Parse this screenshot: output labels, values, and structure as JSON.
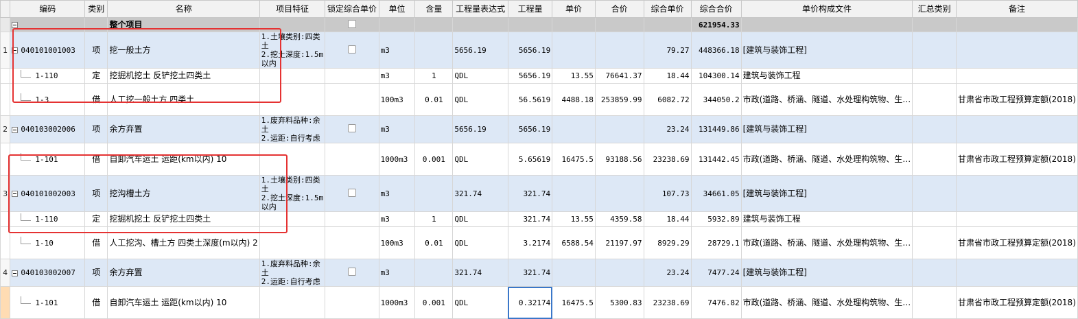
{
  "columns": [
    "编码",
    "类别",
    "名称",
    "项目特征",
    "锁定综合单价",
    "单位",
    "含量",
    "工程量表达式",
    "工程量",
    "单价",
    "合价",
    "综合单价",
    "综合合价",
    "单价构成文件",
    "汇总类别",
    "备注"
  ],
  "highlight_color": "#e53232",
  "whole": {
    "label": "整个项目",
    "total": "621954.33",
    "toggle_icon": "collapse-icon"
  },
  "rows": [
    {
      "type": "qd",
      "num": "1",
      "code": "040101001003",
      "cat": "项",
      "name": "挖一般土方",
      "feat": "1.土壤类别:四类土\n2.挖土深度:1.5m 以内",
      "lock": true,
      "unit": "m3",
      "content": "",
      "expr": "5656.19",
      "qty": "5656.19",
      "price": "",
      "amount": "",
      "cprice": "79.27",
      "ctotal": "448366.18",
      "file": "[建筑与装饰工程]",
      "sum": "",
      "note": ""
    },
    {
      "type": "sub",
      "num": "",
      "code": "1-110",
      "cat": "定",
      "name": "挖掘机挖土 反铲挖土四类土",
      "feat": "",
      "lock": false,
      "unit": "m3",
      "content": "1",
      "expr": "QDL",
      "qty": "5656.19",
      "price": "13.55",
      "amount": "76641.37",
      "cprice": "18.44",
      "ctotal": "104300.14",
      "file": "建筑与装饰工程",
      "sum": "",
      "note": ""
    },
    {
      "type": "sub",
      "num": "",
      "code": "1-3",
      "cat": "借",
      "name": "人工挖一般土方 四类土",
      "feat": "",
      "lock": false,
      "unit": "100m3",
      "content": "0.01",
      "expr": "QDL",
      "qty": "56.5619",
      "price": "4488.18",
      "amount": "253859.99",
      "cprice": "6082.72",
      "ctotal": "344050.2",
      "file": "市政(道路、桥涵、隧道、水处理构筑物、生…",
      "sum": "",
      "note": "甘肃省市政工程预算定额(2018)"
    },
    {
      "type": "qd",
      "num": "2",
      "code": "040103002006",
      "cat": "项",
      "name": "余方弃置",
      "feat": "1.废弃料品种:余土\n2.运距:自行考虑",
      "lock": true,
      "unit": "m3",
      "content": "",
      "expr": "5656.19",
      "qty": "5656.19",
      "price": "",
      "amount": "",
      "cprice": "23.24",
      "ctotal": "131449.86",
      "file": "[建筑与装饰工程]",
      "sum": "",
      "note": ""
    },
    {
      "type": "sub",
      "num": "",
      "code": "1-101",
      "cat": "借",
      "name": "自卸汽车运土 运距(km以内) 10",
      "feat": "",
      "lock": false,
      "unit": "1000m3",
      "content": "0.001",
      "expr": "QDL",
      "qty": "5.65619",
      "price": "16475.5",
      "amount": "93188.56",
      "cprice": "23238.69",
      "ctotal": "131442.45",
      "file": "市政(道路、桥涵、隧道、水处理构筑物、生…",
      "sum": "",
      "note": "甘肃省市政工程预算定额(2018)"
    },
    {
      "type": "qd",
      "num": "3",
      "code": "040101002003",
      "cat": "项",
      "name": "挖沟槽土方",
      "feat": "1.土壤类别:四类土\n2.挖土深度:1.5m 以内",
      "lock": true,
      "unit": "m3",
      "content": "",
      "expr": "321.74",
      "qty": "321.74",
      "price": "",
      "amount": "",
      "cprice": "107.73",
      "ctotal": "34661.05",
      "file": "[建筑与装饰工程]",
      "sum": "",
      "note": ""
    },
    {
      "type": "sub",
      "num": "",
      "code": "1-110",
      "cat": "定",
      "name": "挖掘机挖土 反铲挖土四类土",
      "feat": "",
      "lock": false,
      "unit": "m3",
      "content": "1",
      "expr": "QDL",
      "qty": "321.74",
      "price": "13.55",
      "amount": "4359.58",
      "cprice": "18.44",
      "ctotal": "5932.89",
      "file": "建筑与装饰工程",
      "sum": "",
      "note": ""
    },
    {
      "type": "sub",
      "num": "",
      "code": "1-10",
      "cat": "借",
      "name": "人工挖沟、槽土方 四类土深度(m以内) 2",
      "feat": "",
      "lock": false,
      "unit": "100m3",
      "content": "0.01",
      "expr": "QDL",
      "qty": "3.2174",
      "price": "6588.54",
      "amount": "21197.97",
      "cprice": "8929.29",
      "ctotal": "28729.1",
      "file": "市政(道路、桥涵、隧道、水处理构筑物、生…",
      "sum": "",
      "note": "甘肃省市政工程预算定额(2018)"
    },
    {
      "type": "qd",
      "num": "4",
      "code": "040103002007",
      "cat": "项",
      "name": "余方弃置",
      "feat": "1.废弃料品种:余土\n2.运距:自行考虑",
      "lock": true,
      "unit": "m3",
      "content": "",
      "expr": "321.74",
      "qty": "321.74",
      "price": "",
      "amount": "",
      "cprice": "23.24",
      "ctotal": "7477.24",
      "file": "[建筑与装饰工程]",
      "sum": "",
      "note": ""
    },
    {
      "type": "sub",
      "num": "",
      "code": "1-101",
      "cat": "借",
      "name": "自卸汽车运土 运距(km以内) 10",
      "feat": "",
      "lock": false,
      "unit": "1000m3",
      "content": "0.001",
      "expr": "QDL",
      "qty": "0.32174",
      "price": "16475.5",
      "amount": "5300.83",
      "cprice": "23238.69",
      "ctotal": "7476.82",
      "file": "市政(道路、桥涵、隧道、水处理构筑物、生…",
      "sum": "",
      "note": "甘肃省市政工程预算定额(2018)",
      "selected": true
    }
  ]
}
